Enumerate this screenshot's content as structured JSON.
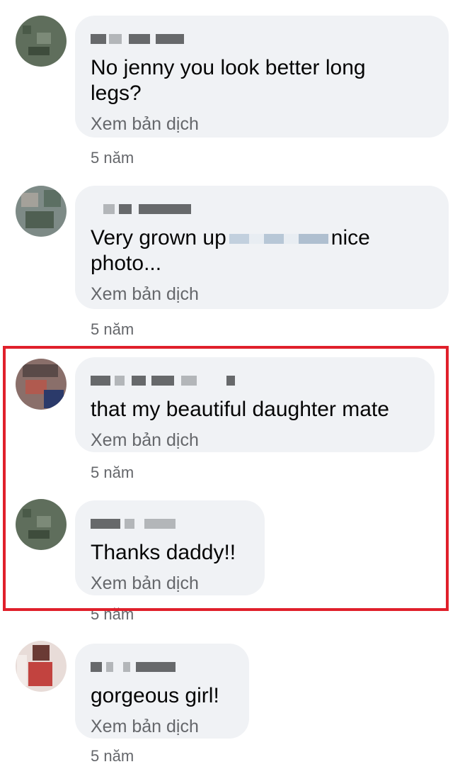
{
  "translate_label": "Xem bản dịch",
  "comments": [
    {
      "text": "No jenny you look better long\nlegs?",
      "time": "5 năm"
    },
    {
      "text_before": "Very grown up",
      "text_after": "nice\nphoto...",
      "time": "5 năm"
    },
    {
      "text": "that my beautiful daughter mate",
      "time": "5 năm"
    },
    {
      "text": "Thanks daddy!!",
      "time": "5 năm"
    },
    {
      "text": "gorgeous girl!",
      "time": "5 năm"
    }
  ],
  "colors": {
    "bubble": "#f0f2f5",
    "text": "#050505",
    "secondary_text": "#65676b",
    "highlight_border": "#e0202b"
  },
  "icons": [
    "avatar-blurred"
  ]
}
